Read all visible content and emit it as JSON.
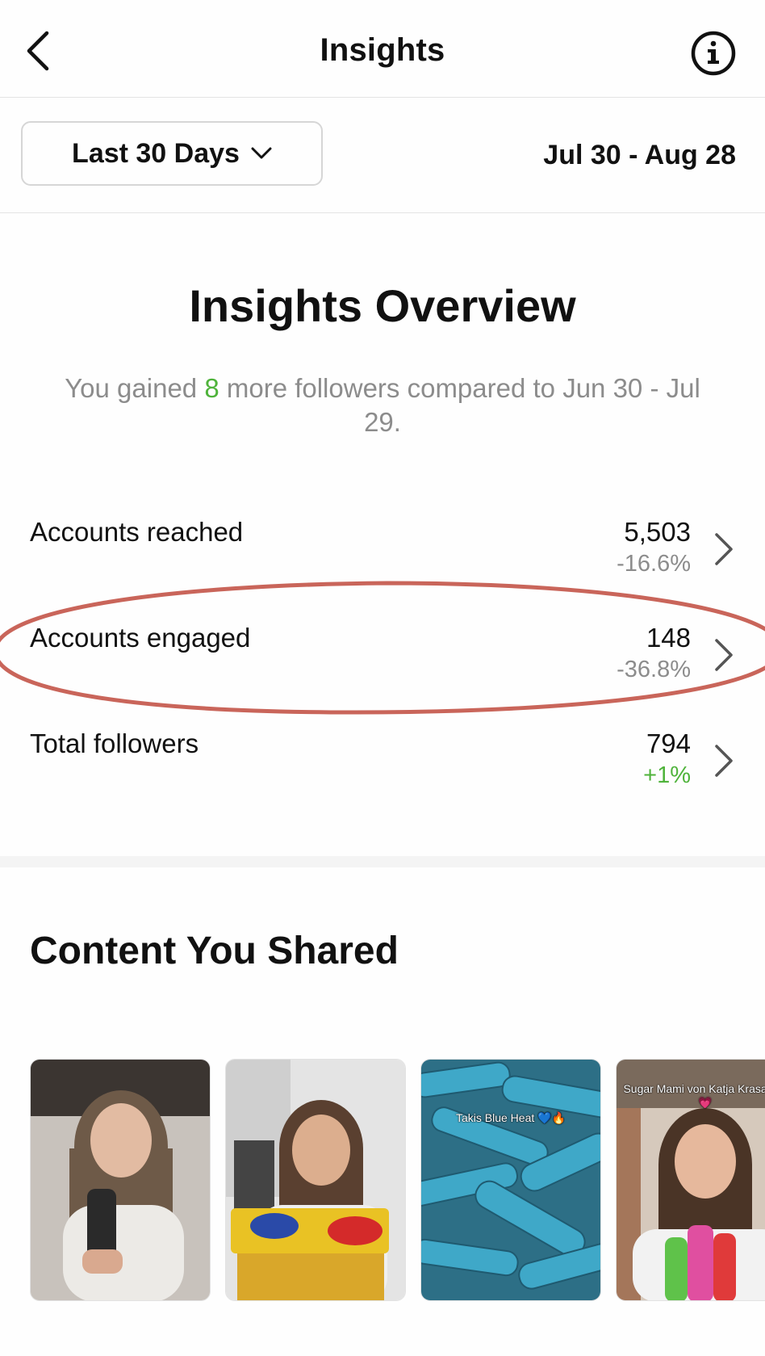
{
  "header": {
    "title": "Insights",
    "back_icon": "chevron-left-icon",
    "info_icon": "info-icon"
  },
  "filter": {
    "range_label": "Last 30 Days",
    "range_icon": "chevron-down-icon",
    "date_range": "Jul 30 - Aug 28"
  },
  "overview": {
    "title": "Insights Overview",
    "text_prefix": "You gained ",
    "gained_count": "8",
    "text_suffix": " more followers compared to Jun 30 - Jul 29."
  },
  "metrics": [
    {
      "label": "Accounts reached",
      "value": "5,503",
      "change": "-16.6%",
      "change_color": "#8c8c8c"
    },
    {
      "label": "Accounts engaged",
      "value": "148",
      "change": "-36.8%",
      "change_color": "#8c8c8c"
    },
    {
      "label": "Total followers",
      "value": "794",
      "change": "+1%",
      "change_color": "#4fb33b"
    }
  ],
  "highlight_color": "#c9655a",
  "content": {
    "title": "Content You Shared",
    "thumbnails": [
      {
        "caption": ""
      },
      {
        "caption": ""
      },
      {
        "caption": "Takis Blue Heat 💙🔥"
      },
      {
        "caption": "Sugar Mami von Katja Krasavice💗"
      }
    ]
  }
}
